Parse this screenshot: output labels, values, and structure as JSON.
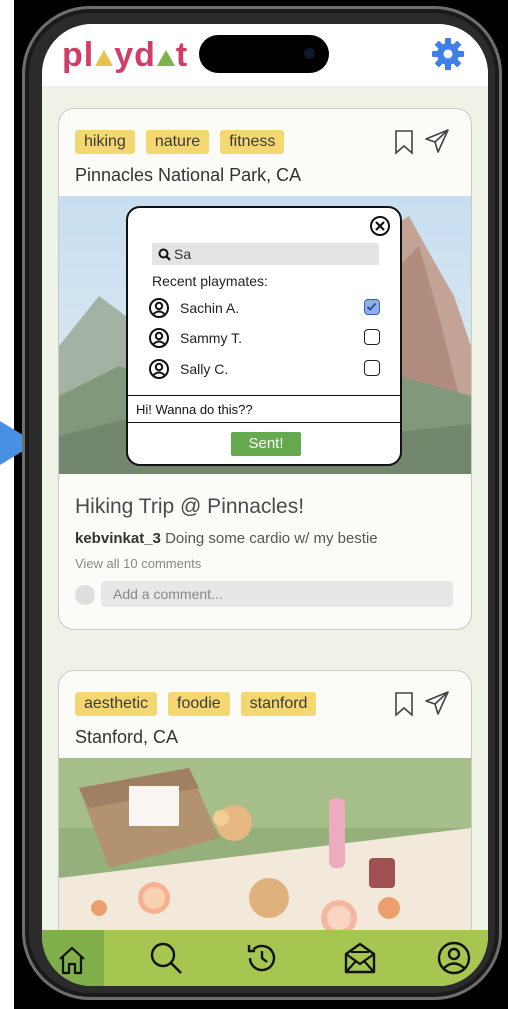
{
  "header": {
    "logo_prefix": "pl",
    "logo_suffix": "yd",
    "logo_tail": "t",
    "settings_icon": "gear-icon",
    "accent": "#3f7fe8"
  },
  "posts": [
    {
      "tags": [
        "hiking",
        "nature",
        "fitness"
      ],
      "location": "Pinnacles National Park, CA",
      "title": "Hiking Trip @ Pinnacles!",
      "caption_user": "kebvinkat_3",
      "caption_text": "Doing some cardio w/ my bestie",
      "view_comments": "View all 10 comments",
      "comment_placeholder": "Add a comment..."
    },
    {
      "tags": [
        "aesthetic",
        "foodie",
        "stanford"
      ],
      "location": "Stanford, CA"
    }
  ],
  "share_modal": {
    "search_value": "Sa",
    "recent_label": "Recent playmates:",
    "playmates": [
      {
        "name": "Sachin A.",
        "checked": true
      },
      {
        "name": "Sammy T.",
        "checked": false
      },
      {
        "name": "Sally C.",
        "checked": false
      }
    ],
    "message": "Hi! Wanna do this??",
    "button_label": "Sent!",
    "button_color": "#64a94d"
  },
  "bottom_nav": [
    "home-icon",
    "search-icon",
    "history-icon",
    "inbox-icon",
    "profile-icon"
  ],
  "colors": {
    "nav_bg": "#a6c651",
    "nav_active": "#7fae4a",
    "tag_bg": "#f4d770",
    "pointer_arrow": "#4a90e2"
  }
}
